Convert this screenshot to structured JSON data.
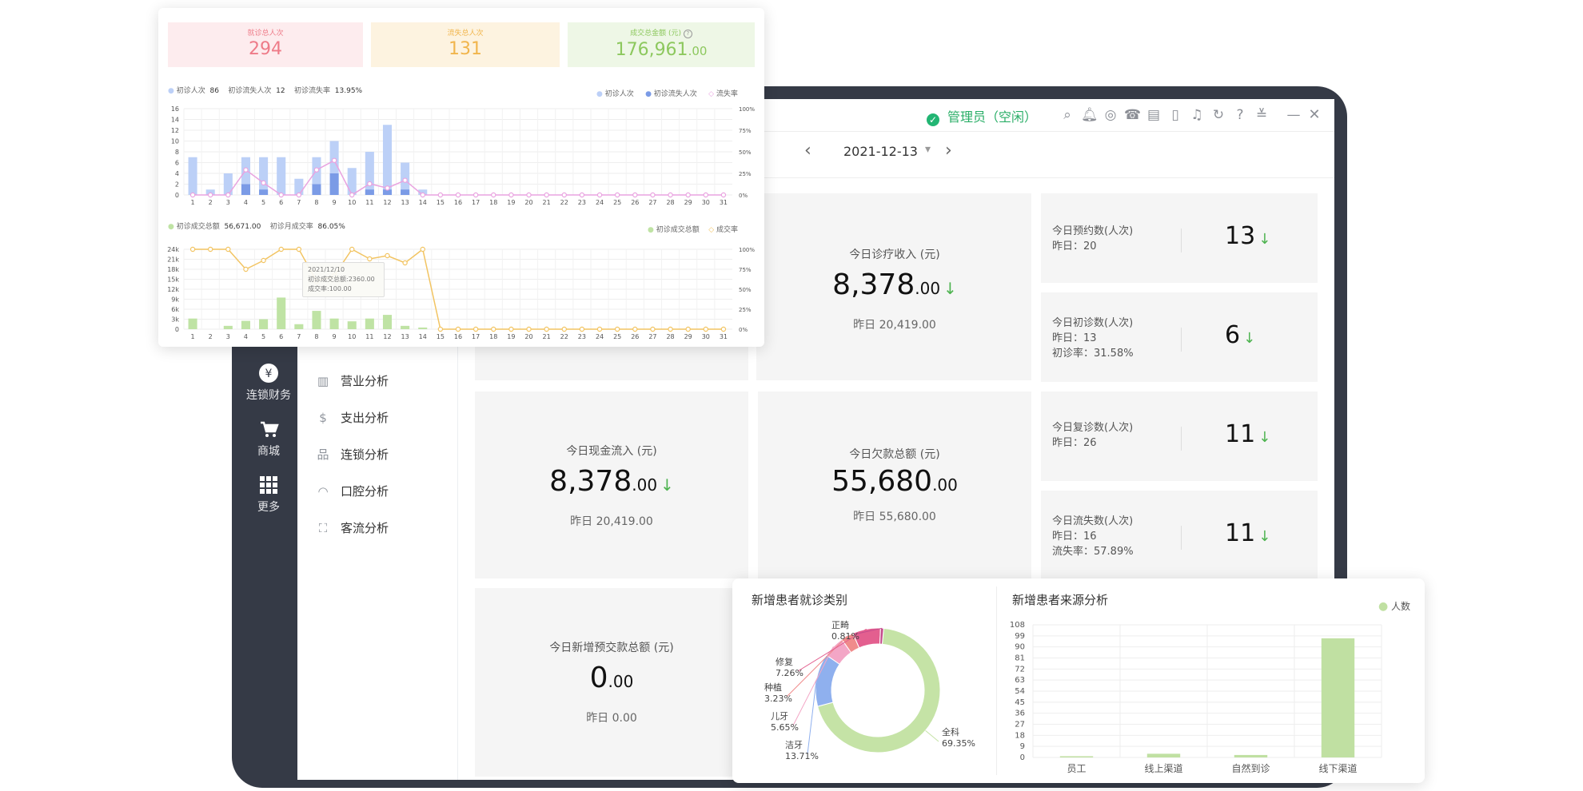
{
  "app": {
    "status_text": "管理员（空闲）",
    "date": "2021-12-13",
    "date_prev_glyph": "‹",
    "date_next_glyph": "›",
    "dropdown_glyph": "▾",
    "window_minimize": "—",
    "window_close": "✕",
    "accent_color": "#22b573"
  },
  "toolbar_icons": [
    "search-icon",
    "bell-icon",
    "support-icon",
    "phone-icon",
    "calculator-icon",
    "tablet-icon",
    "notification-icon",
    "refresh-icon",
    "help-icon",
    "menu-collapse-icon"
  ],
  "sidebar": {
    "items": [
      {
        "label": "连锁财务",
        "icon": "yen-icon",
        "glyph": "¥"
      },
      {
        "label": "商城",
        "icon": "cart-icon",
        "glyph": "🛒"
      },
      {
        "label": "更多",
        "icon": "grid-icon",
        "glyph": "▦"
      }
    ]
  },
  "submenu": {
    "items": [
      {
        "label": "营业分析",
        "icon": "business-chart-icon"
      },
      {
        "label": "支出分析",
        "icon": "money-bag-icon"
      },
      {
        "label": "连锁分析",
        "icon": "chain-org-icon"
      },
      {
        "label": "口腔分析",
        "icon": "mouth-icon"
      },
      {
        "label": "客流分析",
        "icon": "customer-flow-icon"
      }
    ]
  },
  "cards": {
    "income": {
      "label": "今日诊疗收入 (元)",
      "value": "8,378",
      "decimals": ".00",
      "yesterday": "昨日  20,419.00"
    },
    "cash_in": {
      "label": "今日现金流入 (元)",
      "value": "8,378",
      "decimals": ".00",
      "yesterday": "昨日  20,419.00"
    },
    "debt": {
      "label": "今日欠款总额 (元)",
      "value": "55,680",
      "decimals": ".00",
      "yesterday": "昨日  55,680.00"
    },
    "prepay": {
      "label": "今日新增预交款总额 (元)",
      "value": "0",
      "decimals": ".00",
      "yesterday": "昨日  0.00"
    }
  },
  "right_cards": [
    {
      "title": "今日预约数(人次)",
      "line2": "昨日：20",
      "line3": "",
      "value": "13"
    },
    {
      "title": "今日初诊数(人次)",
      "line2": "昨日：13",
      "line3": "初诊率：31.58%",
      "value": "6"
    },
    {
      "title": "今日复诊数(人次)",
      "line2": "昨日：26",
      "line3": "",
      "value": "11"
    },
    {
      "title": "今日流失数(人次)",
      "line2": "昨日：16",
      "line3": "流失率：57.89%",
      "value": "11"
    }
  ],
  "panel_top": {
    "kpis": [
      {
        "label": "就诊总人次",
        "value": "294",
        "decimals": "",
        "bg": "#fdecee",
        "color": "#ee7b88"
      },
      {
        "label": "流失总人次",
        "value": "131",
        "decimals": "",
        "bg": "#fdf3e0",
        "color": "#f1b54c"
      },
      {
        "label": "成交总金额 (元)",
        "value": "176,961",
        "decimals": ".00",
        "bg": "#eef7e6",
        "color": "#8dc85e"
      }
    ],
    "help_glyph": "?",
    "chart1_summary": {
      "l1": "初诊人次",
      "v1": "86",
      "l2": "初诊流失人次",
      "v2": "12",
      "l3": "初诊流失率",
      "v3": "13.95%"
    },
    "chart2_summary": {
      "l1": "初诊成交总额",
      "v1": "56,671.00",
      "l2": "初诊月成交率",
      "v2": "86.05%"
    },
    "tooltip": {
      "date": "2021/12/10",
      "amount": "初诊成交总额:2360.00",
      "rate": "成交率:100.00"
    }
  },
  "panel_bottom": {
    "pie_title": "新增患者就诊类别",
    "bar_title": "新增患者来源分析",
    "bar_legend": "人数"
  },
  "chart_data": [
    {
      "type": "bar",
      "title": "",
      "legend": [
        "初诊人次",
        "初诊流失人次",
        "流失率"
      ],
      "legend_placement": "top-right",
      "x": [
        "1",
        "2",
        "3",
        "4",
        "5",
        "6",
        "7",
        "8",
        "9",
        "10",
        "11",
        "12",
        "13",
        "14",
        "15",
        "16",
        "17",
        "18",
        "19",
        "20",
        "21",
        "22",
        "23",
        "24",
        "25",
        "26",
        "27",
        "28",
        "29",
        "30",
        "31"
      ],
      "y_ticks": [
        "0",
        "2",
        "4",
        "6",
        "8",
        "10",
        "12",
        "14",
        "16"
      ],
      "y2_ticks": [
        "0%",
        "25%",
        "50%",
        "75%",
        "100%"
      ],
      "ylim": [
        0,
        16
      ],
      "y2lim": [
        0,
        100
      ],
      "series": [
        {
          "name": "初诊人次",
          "kind": "bar",
          "color": "#bcd0f7",
          "values": [
            7,
            1,
            4,
            7,
            7,
            7,
            3,
            7,
            10,
            5,
            8,
            13,
            6,
            1,
            0,
            0,
            0,
            0,
            0,
            0,
            0,
            0,
            0,
            0,
            0,
            0,
            0,
            0,
            0,
            0,
            0
          ]
        },
        {
          "name": "初诊流失人次",
          "kind": "bar",
          "color": "#7b9be6",
          "values": [
            0,
            0,
            0,
            2,
            1,
            0,
            0,
            2,
            4,
            0,
            1,
            1,
            1,
            0,
            0,
            0,
            0,
            0,
            0,
            0,
            0,
            0,
            0,
            0,
            0,
            0,
            0,
            0,
            0,
            0,
            0
          ]
        },
        {
          "name": "流失率",
          "kind": "line",
          "color": "#e9a3e0",
          "values": [
            0,
            0,
            0,
            29,
            14,
            0,
            0,
            29,
            40,
            0,
            13,
            8,
            17,
            0,
            0,
            0,
            0,
            0,
            0,
            0,
            0,
            0,
            0,
            0,
            0,
            0,
            0,
            0,
            0,
            0,
            0
          ]
        }
      ]
    },
    {
      "type": "bar",
      "title": "",
      "legend": [
        "初诊成交总额",
        "成交率"
      ],
      "legend_placement": "top-right",
      "x": [
        "1",
        "2",
        "3",
        "4",
        "5",
        "6",
        "7",
        "8",
        "9",
        "10",
        "11",
        "12",
        "13",
        "14",
        "15",
        "16",
        "17",
        "18",
        "19",
        "20",
        "21",
        "22",
        "23",
        "24",
        "25",
        "26",
        "27",
        "28",
        "29",
        "30",
        "31"
      ],
      "y_ticks": [
        "0",
        "3k",
        "6k",
        "9k",
        "12k",
        "15k",
        "18k",
        "21k",
        "24k"
      ],
      "y2_ticks": [
        "0%",
        "25%",
        "50%",
        "75%",
        "100%"
      ],
      "ylim": [
        0,
        24000
      ],
      "y2lim": [
        0,
        100
      ],
      "series": [
        {
          "name": "初诊成交总额",
          "kind": "bar",
          "color": "#bfe3a4",
          "values": [
            3200,
            0,
            1000,
            2500,
            3000,
            9500,
            1500,
            5500,
            3200,
            2360,
            3200,
            4300,
            1000,
            500,
            0,
            0,
            0,
            0,
            0,
            0,
            0,
            0,
            0,
            0,
            0,
            0,
            0,
            0,
            0,
            0,
            0
          ]
        },
        {
          "name": "成交率",
          "kind": "line",
          "color": "#f2c462",
          "values": [
            100,
            100,
            100,
            75,
            86,
            100,
            100,
            60,
            67,
            100,
            88,
            92,
            83,
            100,
            0,
            0,
            0,
            0,
            0,
            0,
            0,
            0,
            0,
            0,
            0,
            0,
            0,
            0,
            0,
            0,
            0
          ]
        }
      ]
    },
    {
      "type": "pie",
      "title": "新增患者就诊类别",
      "categories": [
        "全科",
        "洁牙",
        "儿牙",
        "种植",
        "修复",
        "正畸"
      ],
      "labels": [
        "69.35%",
        "13.71%",
        "5.65%",
        "3.23%",
        "7.26%",
        "0.81%"
      ],
      "values": [
        69.35,
        13.71,
        5.65,
        3.23,
        7.26,
        0.81
      ],
      "colors": [
        "#c5e3a6",
        "#8fb0ee",
        "#f3a6c6",
        "#f08b8b",
        "#e35f8f",
        "#c44b8c"
      ]
    },
    {
      "type": "bar",
      "title": "新增患者来源分析",
      "legend": [
        "人数"
      ],
      "categories": [
        "员工",
        "线上渠道",
        "自然到诊",
        "线下渠道"
      ],
      "values": [
        1,
        3,
        2,
        97
      ],
      "y_ticks": [
        "0",
        "9",
        "18",
        "27",
        "36",
        "45",
        "54",
        "63",
        "72",
        "81",
        "90",
        "99",
        "108"
      ],
      "ylim": [
        0,
        108
      ],
      "color": "#c0e0a2"
    }
  ]
}
